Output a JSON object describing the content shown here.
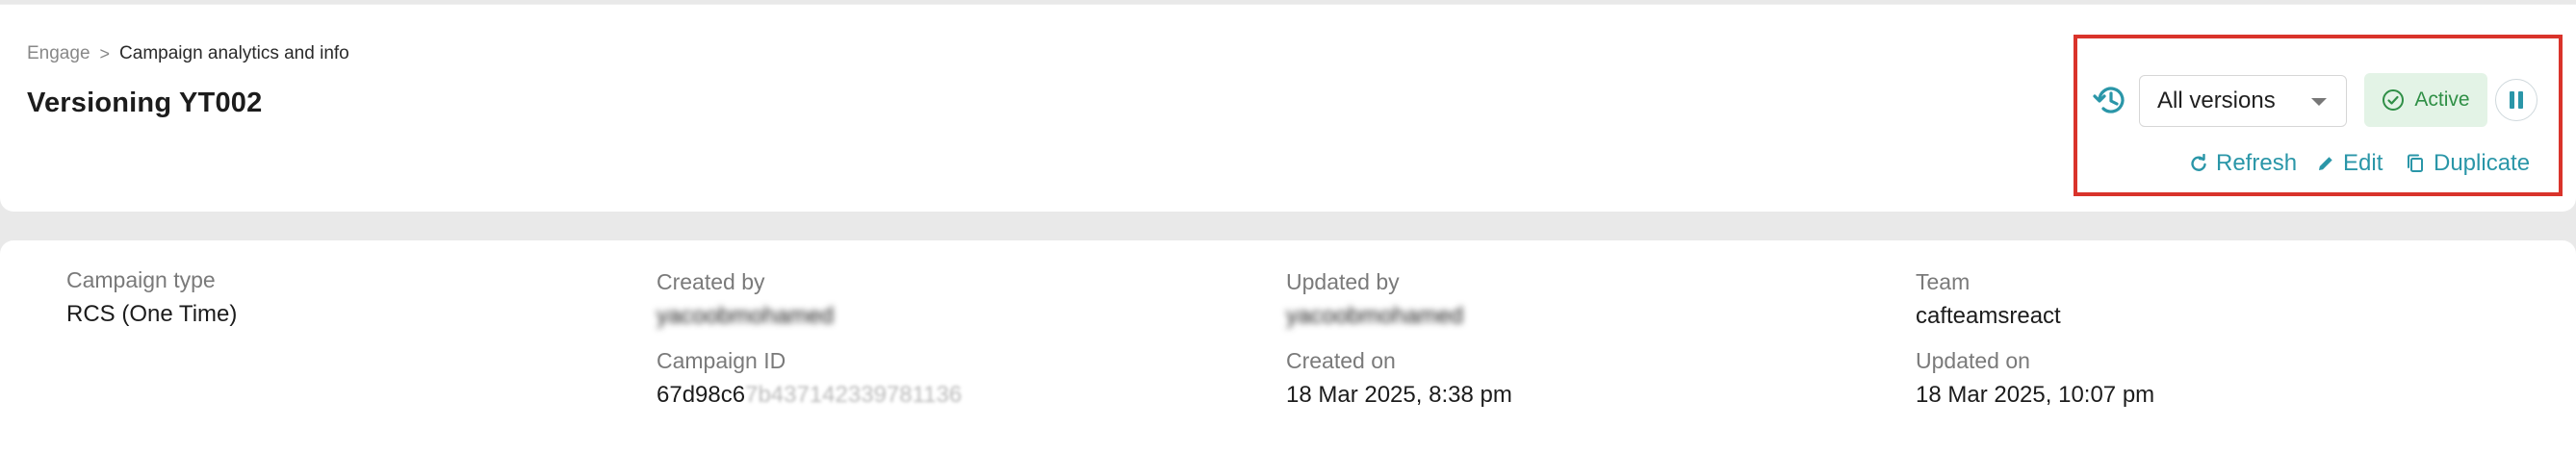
{
  "breadcrumb": {
    "root": "Engage",
    "separator": ">",
    "current": "Campaign analytics and info"
  },
  "title": "Versioning YT002",
  "controls": {
    "history_icon": "history-icon",
    "version_select": {
      "value": "All versions"
    },
    "status": "Active",
    "pause_icon": "pause-icon",
    "refresh_label": "Refresh",
    "edit_label": "Edit",
    "duplicate_label": "Duplicate"
  },
  "details": {
    "campaign_type": {
      "label": "Campaign type",
      "value": "RCS (One Time)"
    },
    "created_by": {
      "label": "Created by",
      "value": "yacoobmohamed"
    },
    "campaign_id": {
      "label": "Campaign ID",
      "value_visible": "67d98c6",
      "value_redacted": "7b437142339781136"
    },
    "updated_by": {
      "label": "Updated by",
      "value": "yacoobmohamed"
    },
    "created_on": {
      "label": "Created on",
      "value": "18 Mar 2025, 8:38 pm"
    },
    "team": {
      "label": "Team",
      "value": "cafteamsreact"
    },
    "updated_on": {
      "label": "Updated on",
      "value": "18 Mar 2025, 10:07 pm"
    }
  },
  "colors": {
    "accent": "#2a96a8",
    "status_bg": "#e3f3e6",
    "status_text": "#2f8f46",
    "highlight": "#d9332b"
  }
}
